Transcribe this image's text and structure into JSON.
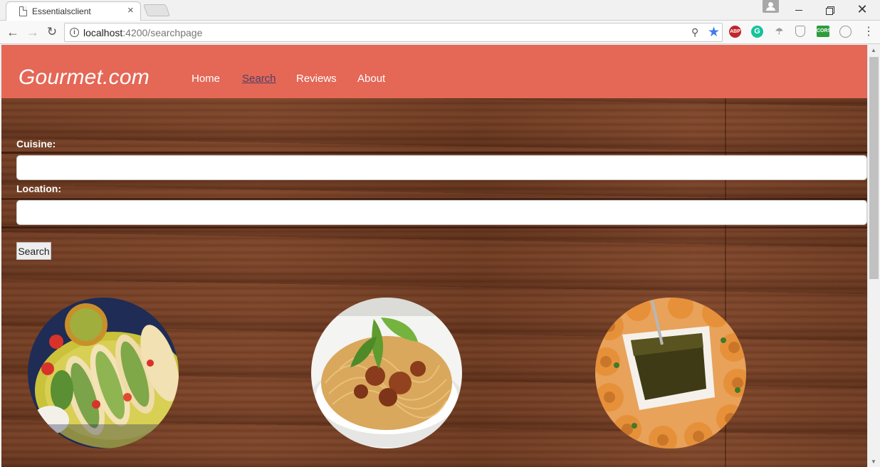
{
  "browser": {
    "tab_title": "Essentialsclient",
    "tab_close": "×",
    "url_host": "localhost",
    "url_path": ":4200/searchpage",
    "info_glyph": "i",
    "back_glyph": "←",
    "forward_glyph": "→",
    "reload_glyph": "↻",
    "zoom_glyph": "⚲",
    "star_glyph": "★",
    "extensions": {
      "abp": "ABP",
      "grammarly": "G",
      "cors": "CORS"
    },
    "menu_glyph": "⋮",
    "win_close_glyph": "✕"
  },
  "site": {
    "brand": "Gourmet.com",
    "nav": {
      "home": "Home",
      "search": "Search",
      "reviews": "Reviews",
      "about": "About"
    },
    "header_color": "#e56756"
  },
  "form": {
    "cuisine_label": "Cuisine:",
    "cuisine_value": "",
    "location_label": "Location:",
    "location_value": "",
    "search_button": "Search"
  },
  "images": [
    {
      "name": "tacos-image"
    },
    {
      "name": "spaghetti-image"
    },
    {
      "name": "samosa-chutney-image"
    }
  ],
  "scrollbar": {
    "up_glyph": "▲",
    "down_glyph": "▼"
  }
}
